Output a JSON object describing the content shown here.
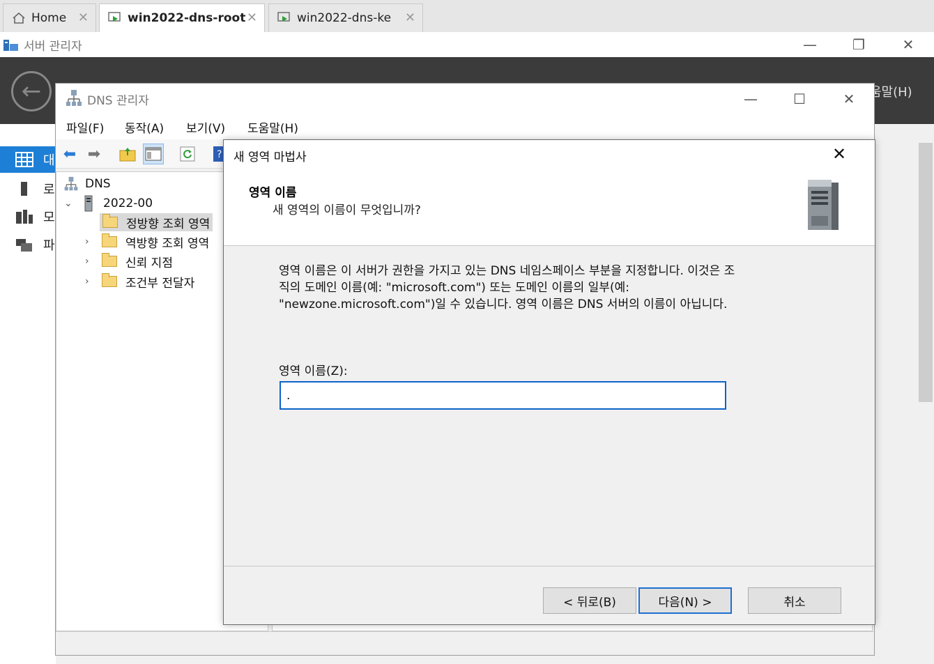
{
  "vm_tabs": [
    {
      "label": "Home"
    },
    {
      "label": "win2022-dns-root"
    },
    {
      "label": "win2022-dns-ke"
    }
  ],
  "server_manager": {
    "title": "서버 관리자",
    "help_menu": "움말(H)",
    "sidebar": [
      {
        "label": "대"
      },
      {
        "label": "로"
      },
      {
        "label": "모"
      },
      {
        "label": "파"
      }
    ]
  },
  "dns_manager": {
    "title": "DNS 관리자",
    "menu": [
      "파일(F)",
      "동작(A)",
      "보기(V)",
      "도움말(H)"
    ],
    "tree": {
      "root": "DNS",
      "server": "2022-00",
      "children": [
        "정방향 조회 영역",
        "역방향 조회 영역",
        "신뢰 지점",
        "조건부 전달자"
      ]
    }
  },
  "wizard": {
    "title": "새 영역 마법사",
    "heading": "영역 이름",
    "subheading": "새 영역의 이름이 무엇입니까?",
    "description_lines": [
      "영역 이름은 이 서버가 권한을 가지고 있는 DNS 네임스페이스 부분을 지정합니다. 이것은 조",
      "직의 도메인 이름(예: \"microsoft.com\") 또는 도메인 이름의 일부(예:",
      "\"newzone.microsoft.com\")일 수 있습니다. 영역 이름은 DNS 서버의 이름이 아닙니다."
    ],
    "zone_name_label": "영역 이름(Z):",
    "zone_name_value": ".",
    "buttons": {
      "back": "< 뒤로(B)",
      "next": "다음(N) >",
      "cancel": "취소"
    }
  }
}
